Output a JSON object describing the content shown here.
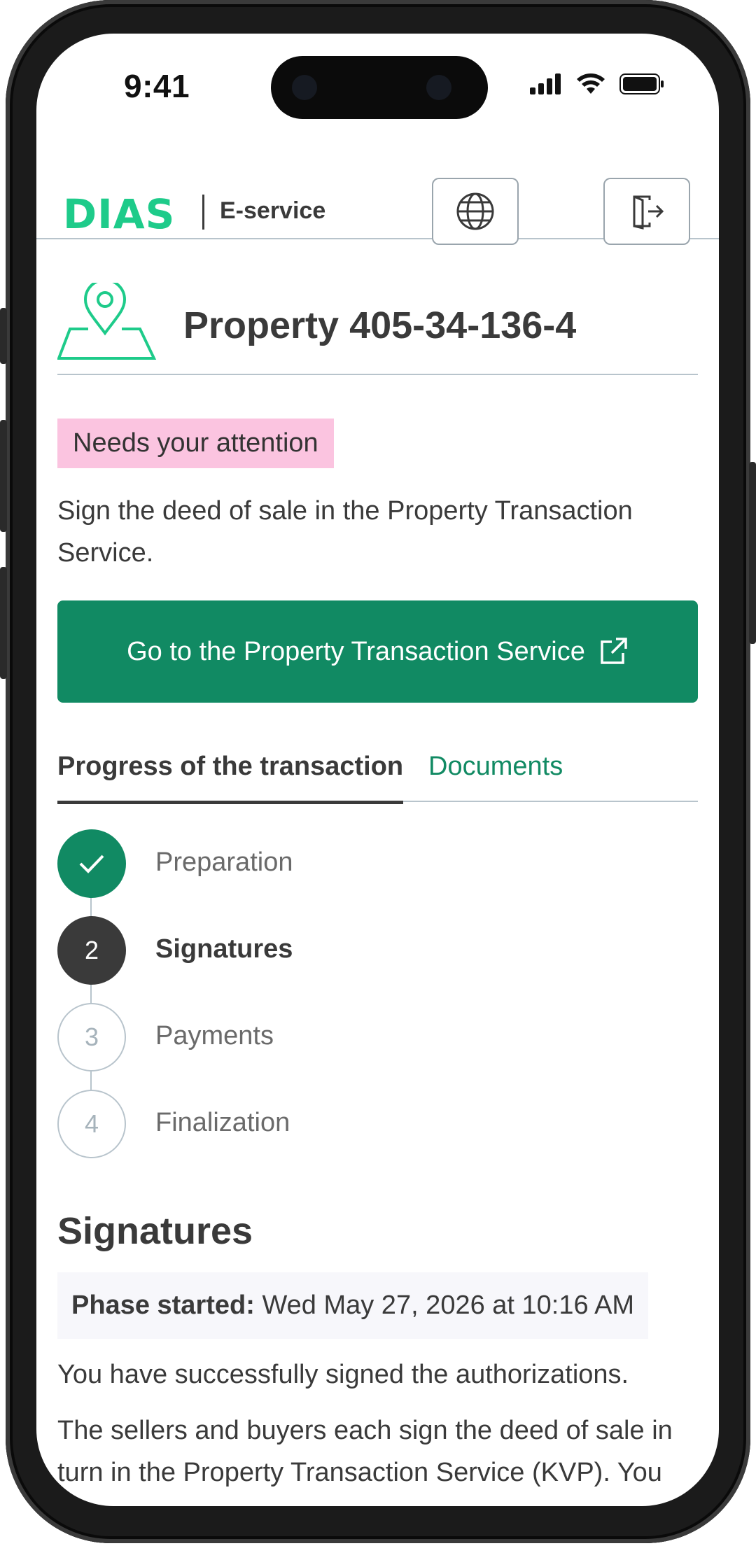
{
  "status_bar": {
    "time": "9:41"
  },
  "header": {
    "logo": "DIAS",
    "service": "E-service",
    "language_button_icon": "globe-icon",
    "logout_button_icon": "logout-icon"
  },
  "property": {
    "icon": "map-pin-icon",
    "title": "Property 405-34-136-4"
  },
  "notice": {
    "badge": "Needs your attention",
    "text": "Sign the deed of sale in the Property Transaction Service.",
    "cta": "Go to the Property Transaction Service"
  },
  "tabs": [
    {
      "label": "Progress of the transaction",
      "active": true
    },
    {
      "label": "Documents",
      "active": false
    }
  ],
  "steps": [
    {
      "number": "",
      "label": "Preparation",
      "state": "done"
    },
    {
      "number": "2",
      "label": "Signatures",
      "state": "current"
    },
    {
      "number": "3",
      "label": "Payments",
      "state": "future"
    },
    {
      "number": "4",
      "label": "Finalization",
      "state": "future"
    }
  ],
  "section": {
    "title": "Signatures",
    "phase_label": "Phase started:",
    "phase_value": "Wed May 27, 2026 at 10:16 AM",
    "paragraph1": "You have successfully signed the authorizations.",
    "paragraph2_line1": "The sellers and buyers each sign the deed of sale in",
    "paragraph2_line2": "turn in the Property Transaction Service (KVP). You"
  },
  "colors": {
    "brand_green": "#1ecb8a",
    "primary": "#118a63",
    "attention_badge": "#fbc4e0",
    "text": "#3a3a3a"
  }
}
